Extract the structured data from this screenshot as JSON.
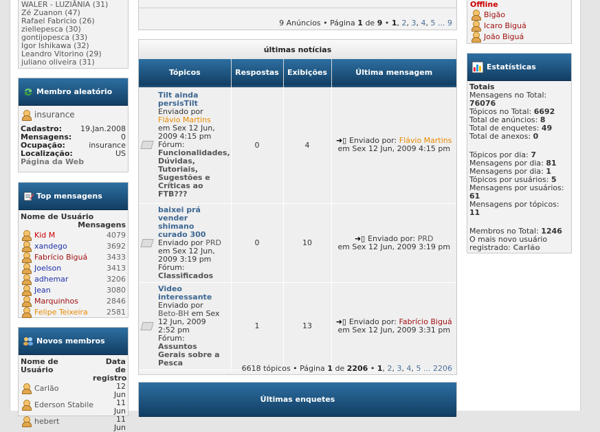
{
  "left_top_list": [
    {
      "name": "WALER - LUZIÂNIA",
      "count": "(31)"
    },
    {
      "name": "Zé Zuanon",
      "count": "(47)"
    },
    {
      "name": "Rafael Fabricio",
      "count": "(26)"
    },
    {
      "name": "ziellepesca",
      "count": "(30)"
    },
    {
      "name": "gontijopesca",
      "count": "(33)"
    },
    {
      "name": "Igor Ishikawa",
      "count": "(32)"
    },
    {
      "name": "Leandro Vitorino",
      "count": "(29)"
    },
    {
      "name": "juliano oliveira",
      "count": "(31)"
    }
  ],
  "random_member": {
    "title": "Membro aleatório",
    "username": "insurance",
    "fields": [
      {
        "label": "Cadastro:",
        "value": "19.Jan.2008"
      },
      {
        "label": "Mensagens:",
        "value": "0"
      },
      {
        "label": "Ocupação:",
        "value": "insurance"
      },
      {
        "label": "Localização:",
        "value": "US"
      }
    ],
    "web_link": "Página da Web"
  },
  "top_posters": {
    "title": "Top mensagens",
    "col_user": "Nome de Usuário",
    "col_msgs": "Mensagens",
    "rows": [
      {
        "name": "Kid M",
        "count": "4079",
        "color": "#cc0000"
      },
      {
        "name": "xandego",
        "count": "3692",
        "color": "#1c2fa8"
      },
      {
        "name": "Fabrício Biguá",
        "count": "3433",
        "color": "#a01010"
      },
      {
        "name": "Joelson",
        "count": "3413",
        "color": "#1c2fa8"
      },
      {
        "name": "adhemar",
        "count": "3206",
        "color": "#1c2fa8"
      },
      {
        "name": "Jean",
        "count": "3080",
        "color": "#1c2fa8"
      },
      {
        "name": "Marquinhos",
        "count": "2846",
        "color": "#a01010"
      },
      {
        "name": "Felipe Teixeira",
        "count": "2581",
        "color": "#e88a00"
      }
    ]
  },
  "new_members": {
    "title": "Novos membros",
    "col_user": "Nome de Usuário",
    "col_date": "Data de registro",
    "rows": [
      {
        "name": "Carlão",
        "date": "12 Jun"
      },
      {
        "name": "Ederson Stabile",
        "date": "11 Jun"
      },
      {
        "name": "hebert",
        "date": "11 Jun"
      }
    ]
  },
  "ads_pagination": {
    "prefix": "9 Anúncios • Página",
    "current": "1",
    "of": "de",
    "total": "9",
    "sep": "•",
    "pages": [
      "1",
      "2",
      "3",
      "4",
      "5",
      "...",
      "9"
    ]
  },
  "news": {
    "caption": "últimas notícias",
    "headers": [
      "Tópicos",
      "Respostas",
      "Exibições",
      "Última mensagem"
    ],
    "rows": [
      {
        "title": "Tilt ainda persisTilt",
        "sent_by": "Enviado por",
        "author": "Flávio Martins",
        "author_color": "#e88a00",
        "date": "em Sex 12 Jun, 2009 4:15 pm",
        "forum_label": "Fórum:",
        "forum": "Funcionalidades, Dúvidas, Tutoriais, Sugestões e Críticas ao FTB???",
        "replies": "0",
        "views": "4",
        "last_prefix": "Enviado por:",
        "last_author": "Flávio Martins",
        "last_color": "#e88a00",
        "last_date": "em Sex 12 Jun, 2009 4:15 pm"
      },
      {
        "title": "baixei prá vender shimano curado 300",
        "sent_by": "Enviado por",
        "author": "PRD",
        "author_color": "#555555",
        "date": "em Sex 12 Jun, 2009 3:19 pm",
        "forum_label": "Fórum:",
        "forum": "Classificados",
        "replies": "0",
        "views": "10",
        "last_prefix": "Enviado por:",
        "last_author": "PRD",
        "last_color": "#555555",
        "last_date": "em Sex 12 Jun, 2009 3:19 pm"
      },
      {
        "title": "Video interessante",
        "sent_by": "Enviado por",
        "author": "Beto-BH",
        "author_color": "#555555",
        "date": "em Sex 12 Jun, 2009 2:52 pm",
        "forum_label": "Fórum:",
        "forum": "Assuntos Gerais sobre a Pesca",
        "replies": "1",
        "views": "13",
        "last_prefix": "Enviado por:",
        "last_author": "Fabrício Biguá",
        "last_color": "#a01010",
        "last_date": "em Sex 12 Jun, 2009 3:31 pm"
      }
    ],
    "pagination": {
      "prefix": "6618 tópicos • Página",
      "current": "1",
      "of": "de",
      "total": "2206",
      "sep": "•",
      "pages": [
        "1",
        "2",
        "3",
        "4",
        "5",
        "...",
        "2206"
      ]
    }
  },
  "polls": {
    "title": "Últimas enquetes"
  },
  "online": {
    "status": "Offline",
    "users": [
      {
        "name": "Bigão",
        "color": "#a01010"
      },
      {
        "name": "Icaro Biguá",
        "color": "#a01010"
      },
      {
        "name": "João Biguá",
        "color": "#a01010"
      }
    ]
  },
  "stats": {
    "title": "Estatísticas",
    "totals_label": "Totais",
    "group1": [
      {
        "label": "Mensagens no Total:",
        "value": "76076"
      },
      {
        "label": "Tópicos no Total:",
        "value": "6692"
      },
      {
        "label": "Total de anúncios:",
        "value": "8"
      },
      {
        "label": "Total de enquetes:",
        "value": "49"
      },
      {
        "label": "Total de anexos:",
        "value": "0"
      }
    ],
    "group2": [
      {
        "label": "Tópicos por dia:",
        "value": "7"
      },
      {
        "label": "Mensagens por dia:",
        "value": "81"
      },
      {
        "label": "Mensagens por dia:",
        "value": "1"
      },
      {
        "label": "Tópicos por usuários:",
        "value": "5"
      },
      {
        "label": "Mensagens por usuários:",
        "value": "61"
      },
      {
        "label": "Mensagens por tópicos:",
        "value": "11"
      }
    ],
    "members_label": "Membros no Total:",
    "members_value": "1246",
    "newest_label": "O mais novo usuário registrado:",
    "newest_value": "Carlão"
  }
}
